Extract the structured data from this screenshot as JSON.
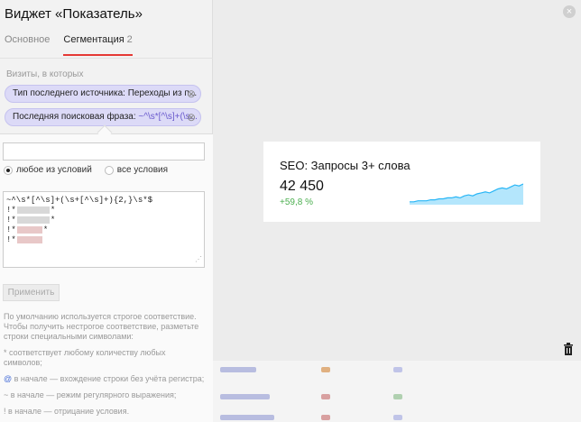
{
  "panel": {
    "title": "Виджет «Показатель»",
    "tabs": [
      {
        "label": "Основное"
      },
      {
        "label": "Сегментация",
        "count": "2"
      }
    ],
    "visits_label": "Визиты, в которых",
    "chips": [
      {
        "label": "Тип последнего источника: Переходы из п...",
        "value": ""
      },
      {
        "label": "Последняя поисковая фраза: ",
        "value": "~^\\s*[^\\s]+(\\s..."
      }
    ]
  },
  "popup": {
    "search_placeholder": "",
    "radio_any": "любое из условий",
    "radio_all": "все условия",
    "textarea_lines": [
      "~^\\s*[^\\s]+(\\s+[^\\s]+){2,}\\s*$",
      "!*",
      "!*",
      "!*",
      "!*"
    ],
    "apply": "Применить",
    "help": {
      "intro": "По умолчанию используется строгое соответствие. Чтобы получить нестрогое соответствие, разметьте строки специальными символами:",
      "star": "* соответствует любому количеству любых символов;",
      "at_symbol": "@",
      "at_text": " в начале — вхождение строки без учёта регистра;",
      "tilde": "~ в начале — режим регулярного выражения;",
      "bang": "! в начале — отрицание условия."
    }
  },
  "card": {
    "title": "SEO: Запросы 3+ слова",
    "value": "42 450",
    "delta": "+59,8 %"
  },
  "chart_data": {
    "type": "area",
    "values": [
      2,
      2,
      3,
      3,
      3,
      4,
      4,
      5,
      5,
      6,
      6,
      7,
      6,
      8,
      9,
      8,
      10,
      11,
      12,
      11,
      13,
      15,
      16,
      15,
      17,
      19,
      18,
      20
    ],
    "color": "#29b6f6"
  },
  "colors": {
    "accent": "#e53935",
    "chip_bg": "#dcdaf7",
    "delta_positive": "#4caf50"
  },
  "icons": {
    "close": "close-icon",
    "trash": "trash-icon",
    "chip_remove": "remove-chip-icon"
  }
}
